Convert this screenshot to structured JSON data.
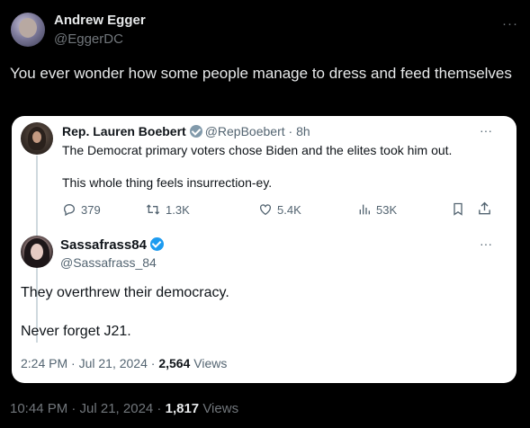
{
  "outer_tweet": {
    "author_name": "Andrew Egger",
    "handle": "@EggerDC",
    "text": "You ever wonder how some people manage to dress and feed themselves",
    "time": "10:44 PM · Jul 21, 2024 · ",
    "views_count": "1,817",
    "views_label": " Views",
    "more": "···"
  },
  "quoted_thread": {
    "boebert": {
      "name": "Rep. Lauren Boebert",
      "handle_time": "@RepBoebert · 8h",
      "line1": "The Democrat primary voters chose Biden and the elites took him out.",
      "line2": "This whole thing feels insurrection-ey.",
      "replies": "379",
      "reposts": "1.3K",
      "likes": "5.4K",
      "views": "53K",
      "more": "···"
    },
    "sassafrass": {
      "name": "Sassafrass84",
      "handle": "@Sassafrass_84",
      "line1": "They overthrew their democracy.",
      "line2": "Never forget J21.",
      "time": "2:24 PM · Jul 21, 2024 · ",
      "views_count": "2,564",
      "views_label": " Views",
      "more": "···"
    }
  },
  "icons": {
    "reply": "reply-icon",
    "repost": "repost-icon",
    "like": "heart-icon",
    "views": "views-icon",
    "bookmark": "bookmark-icon",
    "share": "share-icon",
    "verified_gray": "verified-gray-icon",
    "verified_blue": "verified-blue-icon"
  },
  "colors": {
    "background": "#000000",
    "card": "#ffffff",
    "secondary_text": "#71767b",
    "verified_blue": "#1d9bf0"
  }
}
